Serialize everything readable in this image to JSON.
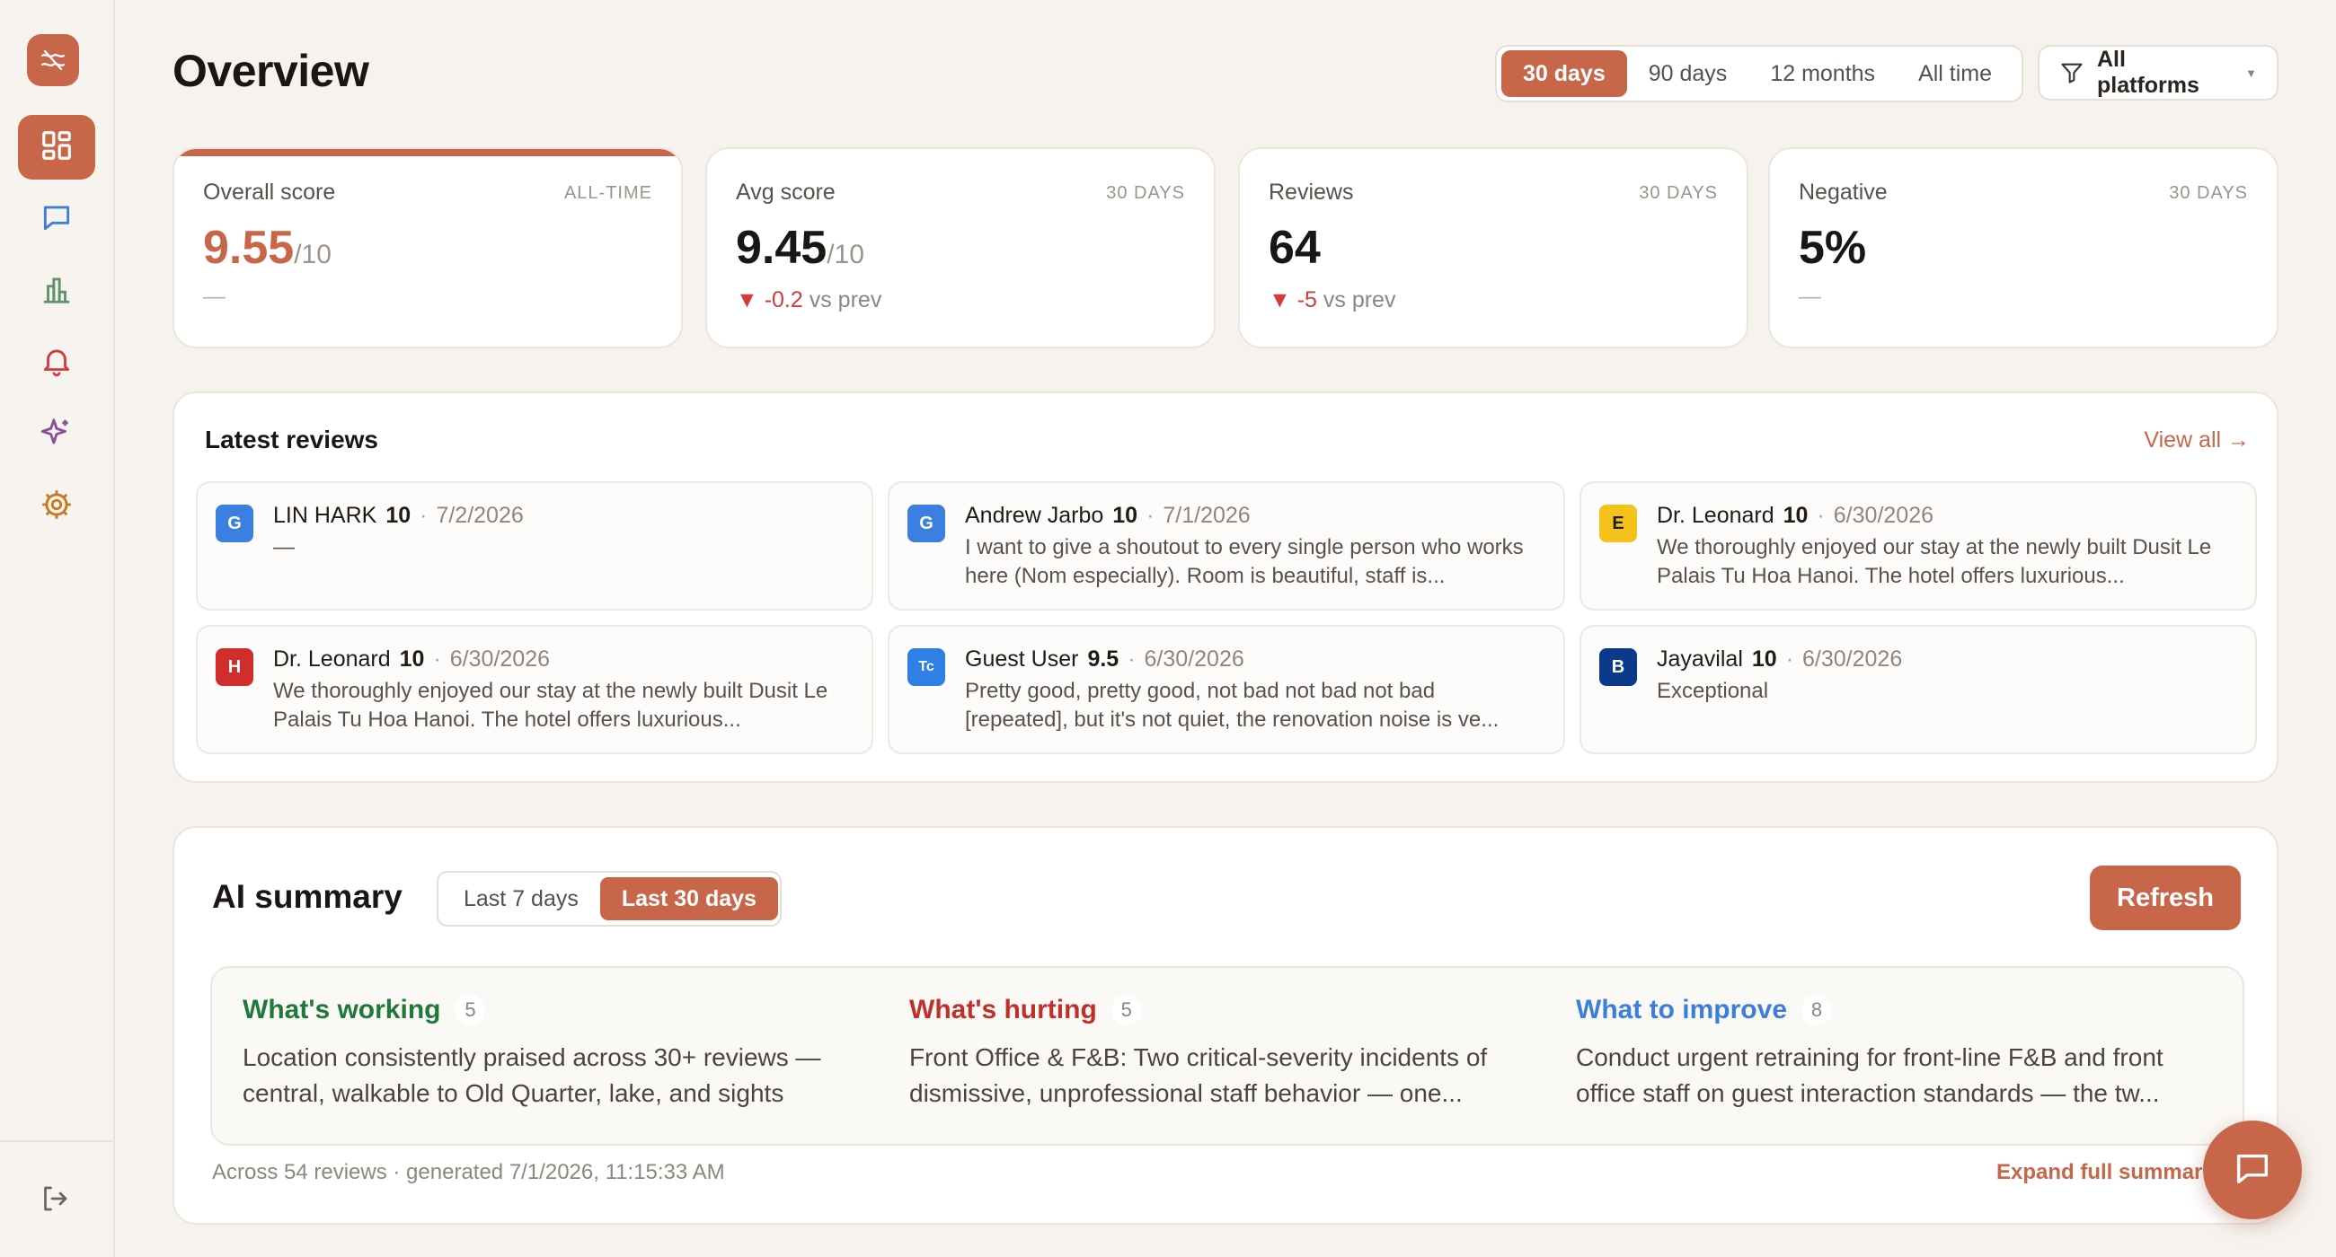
{
  "colors": {
    "accent": "#c8664a",
    "positive": "#1f7a3a",
    "negative": "#c0302b",
    "info": "#3b7fd8"
  },
  "sidebar": {
    "logo_icon": "wave-logo-icon",
    "items": [
      {
        "icon": "dashboard-icon",
        "active": true
      },
      {
        "icon": "chat-icon",
        "active": false
      },
      {
        "icon": "bar-chart-icon",
        "active": false
      },
      {
        "icon": "bell-icon",
        "active": false
      },
      {
        "icon": "sparkle-icon",
        "active": false
      },
      {
        "icon": "gear-icon",
        "active": false
      }
    ],
    "logout_icon": "logout-icon"
  },
  "header": {
    "title": "Overview",
    "ranges": [
      "30 days",
      "90 days",
      "12 months",
      "All time"
    ],
    "active_range": "30 days",
    "platform_filter": "All platforms"
  },
  "stats": [
    {
      "label": "Overall score",
      "period": "ALL-TIME",
      "value": "9.55",
      "unit": "/10",
      "delta": "",
      "delta_suffix": "",
      "empty": "—"
    },
    {
      "label": "Avg score",
      "period": "30 DAYS",
      "value": "9.45",
      "unit": "/10",
      "delta": "▼ -0.2",
      "delta_suffix": "vs prev"
    },
    {
      "label": "Reviews",
      "period": "30 DAYS",
      "value": "64",
      "unit": "",
      "delta": "▼ -5",
      "delta_suffix": "vs prev"
    },
    {
      "label": "Negative",
      "period": "30 DAYS",
      "value": "5%",
      "unit": "",
      "delta": "",
      "delta_suffix": "",
      "empty": "—"
    }
  ],
  "latest_reviews": {
    "title": "Latest reviews",
    "view_all": "View all →",
    "items": [
      {
        "badge": "G",
        "badge_color": "#3b7fe0",
        "name": "LIN HARK",
        "score": "10",
        "date": "7/2/2026",
        "text": "—"
      },
      {
        "badge": "G",
        "badge_color": "#3b7fe0",
        "name": "Andrew Jarbo",
        "score": "10",
        "date": "7/1/2026",
        "text": "I want to give a shoutout to every single person who works here (Nom especially). Room is beautiful, staff is..."
      },
      {
        "badge": "E",
        "badge_color": "#f4c21b",
        "name": "Dr. Leonard",
        "score": "10",
        "date": "6/30/2026",
        "text": "We thoroughly enjoyed our stay at the newly built Dusit Le Palais Tu Hoa Hanoi. The hotel offers luxurious..."
      },
      {
        "badge": "H",
        "badge_color": "#d12d2d",
        "name": "Dr. Leonard",
        "score": "10",
        "date": "6/30/2026",
        "text": "We thoroughly enjoyed our stay at the newly built Dusit Le Palais Tu Hoa Hanoi. The hotel offers luxurious..."
      },
      {
        "badge": "Tc",
        "badge_color": "#2f7fe6",
        "name": "Guest User",
        "score": "9.5",
        "date": "6/30/2026",
        "text": "Pretty good, pretty good, not bad not bad not bad [repeated], but it's not quiet, the renovation noise is ve..."
      },
      {
        "badge": "B",
        "badge_color": "#0c3a8a",
        "name": "Jayavilal",
        "score": "10",
        "date": "6/30/2026",
        "text": "Exceptional"
      }
    ]
  },
  "ai_summary": {
    "title": "AI summary",
    "tabs": [
      "Last 7 days",
      "Last 30 days"
    ],
    "active_tab": "Last 30 days",
    "refresh": "Refresh",
    "columns": [
      {
        "title": "What's working",
        "count": "5",
        "color": "#1f7a3a",
        "text": "Location consistently praised across 30+ reviews — central, walkable to Old Quarter, lake, and sights"
      },
      {
        "title": "What's hurting",
        "count": "5",
        "color": "#c0302b",
        "text": "Front Office & F&B: Two critical-severity incidents of dismissive, unprofessional staff behavior — one..."
      },
      {
        "title": "What to improve",
        "count": "8",
        "color": "#3b7fd8",
        "text": "Conduct urgent retraining for front-line F&B and front office staff on guest interaction standards — the tw..."
      }
    ],
    "footer": "Across 54 reviews · generated 7/1/2026, 11:15:33 AM",
    "expand": "Expand full summar"
  },
  "chat_fab_icon": "chat-bubble-icon"
}
